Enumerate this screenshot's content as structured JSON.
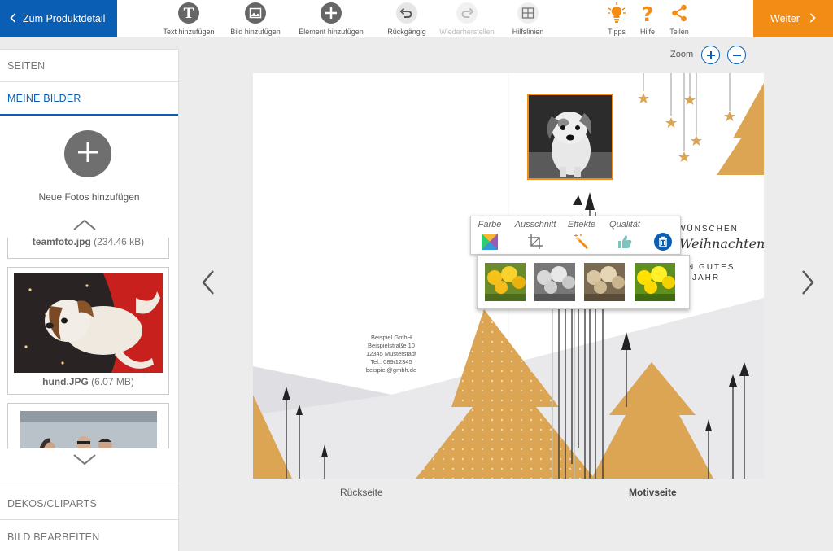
{
  "toolbar": {
    "back_label": "Zum Produktdetail",
    "next_label": "Weiter",
    "tools": {
      "text": "Text hinzufügen",
      "image": "Bild hinzufügen",
      "element": "Element hinzufügen",
      "undo": "Rückgängig",
      "redo": "Wiederherstellen",
      "guides": "Hilfslinien",
      "tips": "Tipps",
      "help": "Hilfe",
      "share": "Teilen"
    }
  },
  "sidebar": {
    "sections": {
      "pages": "SEITEN",
      "my_images": "MEINE BILDER",
      "decos": "DEKOS/CLIPARTS",
      "edit_image": "BILD BEARBEITEN"
    },
    "add_photos_label": "Neue Fotos hinzufügen",
    "files": [
      {
        "name": "teamfoto.jpg",
        "size": "(234.46 kB)"
      },
      {
        "name": "hund.JPG",
        "size": "(6.07 MB)"
      }
    ]
  },
  "canvas": {
    "zoom_label": "Zoom",
    "pages": {
      "back": "Rückseite",
      "front": "Motivseite"
    },
    "address": {
      "line1": "Beispiel GmbH",
      "line2": "Beispielstraße 10",
      "line3": "12345 Musterstadt",
      "line4": "Tel.: 089/12345",
      "line5": "beispiel@gmbh.de"
    },
    "greeting": {
      "line1": "WÜNSCHEN",
      "line2": "Weihnachten",
      "line3": "N GUTES",
      "line4": "JAHR"
    }
  },
  "edit_bar": {
    "color": "Farbe",
    "crop": "Ausschnitt",
    "effects": "Effekte",
    "quality": "Qualität"
  },
  "colors": {
    "brand_blue": "#0a5fb4",
    "accent_orange": "#f28c14",
    "tree_gold": "#dca554"
  }
}
